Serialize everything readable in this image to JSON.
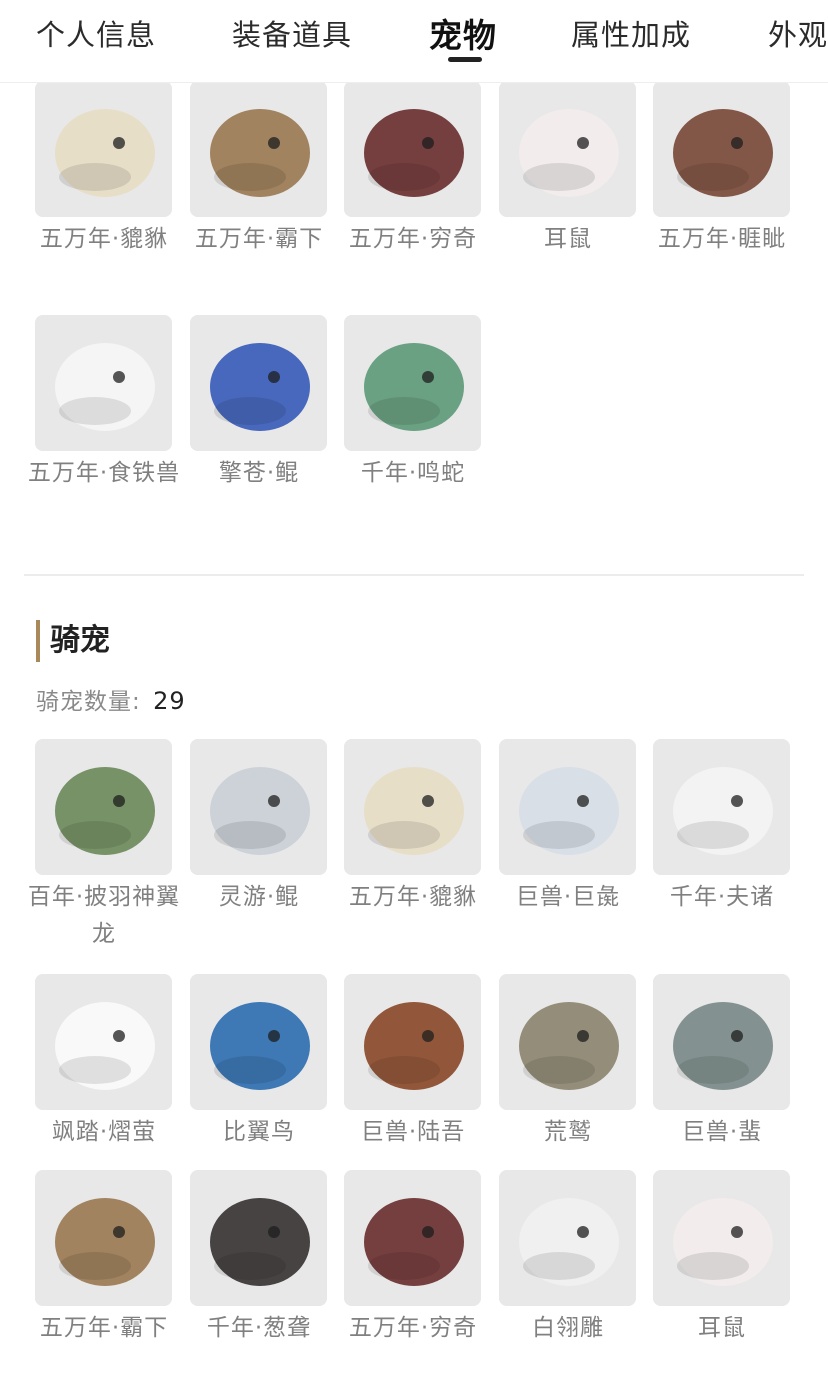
{
  "tabs": [
    {
      "label": "个人信息",
      "active": false
    },
    {
      "label": "装备道具",
      "active": false
    },
    {
      "label": "宠物",
      "active": true
    },
    {
      "label": "属性加成",
      "active": false
    },
    {
      "label": "外观",
      "active": false
    }
  ],
  "pets": {
    "items": [
      {
        "name": "五万年·貔貅",
        "icon": "lion-mask-icon",
        "color": "#e6dcc4"
      },
      {
        "name": "五万年·霸下",
        "icon": "dragon-turtle-icon",
        "color": "#9a7a52"
      },
      {
        "name": "五万年·穷奇",
        "icon": "red-beast-icon",
        "color": "#6b3030"
      },
      {
        "name": "耳鼠",
        "icon": "rat-icon",
        "color": "#f2ecec"
      },
      {
        "name": "五万年·睚眦",
        "icon": "red-dragon-icon",
        "color": "#7a4a3a"
      },
      {
        "name": "五万年·食铁兽",
        "icon": "panda-icon",
        "color": "#f5f5f5"
      },
      {
        "name": "擎苍·鲲",
        "icon": "blue-fish-icon",
        "color": "#3a5cb8"
      },
      {
        "name": "千年·鸣蛇",
        "icon": "green-snake-icon",
        "color": "#5e9a78"
      }
    ]
  },
  "mounts": {
    "title": "骑宠",
    "count_label": "骑宠数量:",
    "count_value": "29",
    "items": [
      {
        "name": "百年·披羽神翼龙",
        "icon": "pterodactyl-icon",
        "color": "#6b8a5a"
      },
      {
        "name": "灵游·鲲",
        "icon": "spirit-fish-icon",
        "color": "#c9cfd6"
      },
      {
        "name": "五万年·貔貅",
        "icon": "lion-mask-icon",
        "color": "#e6dcc4"
      },
      {
        "name": "巨兽·巨彘",
        "icon": "white-boar-icon",
        "color": "#d7dde6"
      },
      {
        "name": "千年·夫诸",
        "icon": "white-deer-icon",
        "color": "#f3f3f3"
      },
      {
        "name": "飒踏·熠萤",
        "icon": "white-spirit-icon",
        "color": "#fafafa"
      },
      {
        "name": "比翼鸟",
        "icon": "blue-bird-icon",
        "color": "#2f6fb0"
      },
      {
        "name": "巨兽·陆吾",
        "icon": "tiger-beast-icon",
        "color": "#8a4a2a"
      },
      {
        "name": "荒鹫",
        "icon": "vulture-icon",
        "color": "#8c8470"
      },
      {
        "name": "巨兽·蜚",
        "icon": "horned-beast-icon",
        "color": "#7a8a88"
      },
      {
        "name": "五万年·霸下",
        "icon": "dragon-turtle-icon",
        "color": "#9a7a52"
      },
      {
        "name": "千年·葱聋",
        "icon": "dark-goat-icon",
        "color": "#3a3434"
      },
      {
        "name": "五万年·穷奇",
        "icon": "red-beast-icon",
        "color": "#6b3030"
      },
      {
        "name": "白翎雕",
        "icon": "white-eagle-icon",
        "color": "#f0f0f0"
      },
      {
        "name": "耳鼠",
        "icon": "rat-icon",
        "color": "#f2ecec"
      }
    ]
  }
}
